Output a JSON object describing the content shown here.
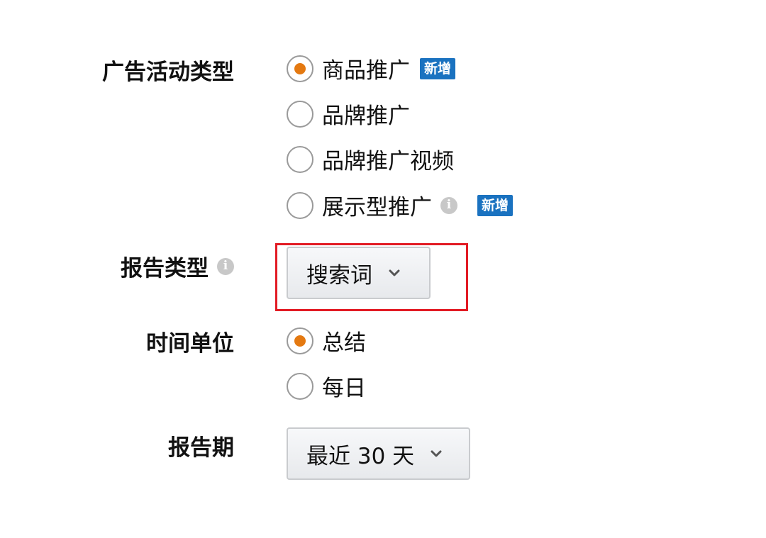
{
  "campaign_type": {
    "label": "广告活动类型",
    "options": [
      {
        "label": "商品推广",
        "selected": true,
        "badge": "新增"
      },
      {
        "label": "品牌推广",
        "selected": false
      },
      {
        "label": "品牌推广视频",
        "selected": false
      },
      {
        "label": "展示型推广",
        "selected": false,
        "info": true,
        "badge": "新增"
      }
    ]
  },
  "report_type": {
    "label": "报告类型",
    "value": "搜索词"
  },
  "time_unit": {
    "label": "时间单位",
    "options": [
      {
        "label": "总结",
        "selected": true
      },
      {
        "label": "每日",
        "selected": false
      }
    ]
  },
  "report_period": {
    "label": "报告期",
    "value": "最近 30 天"
  },
  "colors": {
    "accent": "#e47911",
    "badge": "#1a72c0",
    "highlight": "#e21b24"
  }
}
